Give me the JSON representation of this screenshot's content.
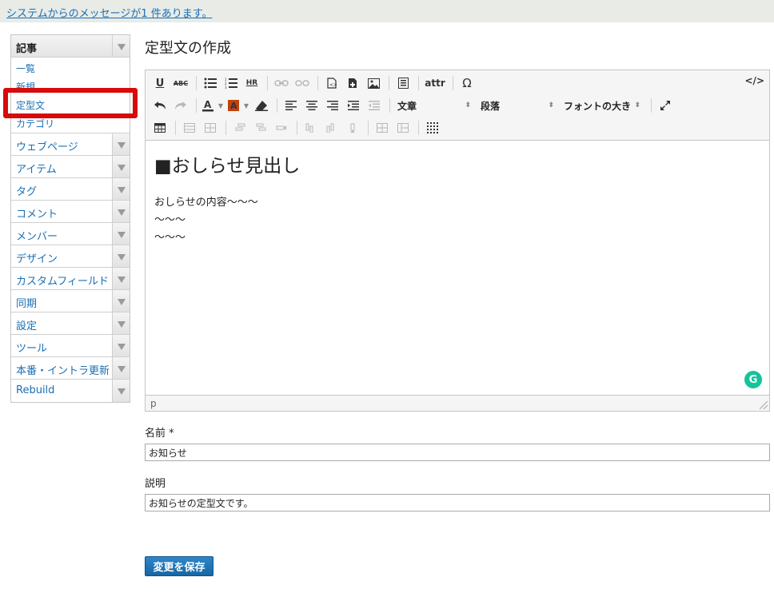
{
  "system_message": "システムからのメッセージが1 件あります。",
  "sidebar": {
    "header": "記事",
    "sub_items": [
      "一覧",
      "新規",
      "定型文",
      "カテゴリ"
    ],
    "items": [
      "ウェブページ",
      "アイテム",
      "タグ",
      "コメント",
      "メンバー",
      "デザイン",
      "カスタムフィールド",
      "同期",
      "設定",
      "ツール",
      "本番・イントラ更新",
      "Rebuild"
    ]
  },
  "page_title": "定型文の作成",
  "toolbar": {
    "underline": "U",
    "strike": "ABC",
    "hr": "HR",
    "attr": "attr",
    "omega": "Ω",
    "source": "</>",
    "format_select": "文章",
    "block_select": "段落",
    "fontsize_select": "フォントの大き"
  },
  "editor": {
    "heading": "■おしらせ見出し",
    "lines": [
      "おしらせの内容〜〜〜",
      "〜〜〜",
      "〜〜〜"
    ],
    "status_path": "p",
    "grammarly": "G"
  },
  "form": {
    "name_label": "名前 *",
    "name_value": "お知らせ",
    "desc_label": "説明",
    "desc_value": "お知らせの定型文です。",
    "save_label": "変更を保存"
  }
}
